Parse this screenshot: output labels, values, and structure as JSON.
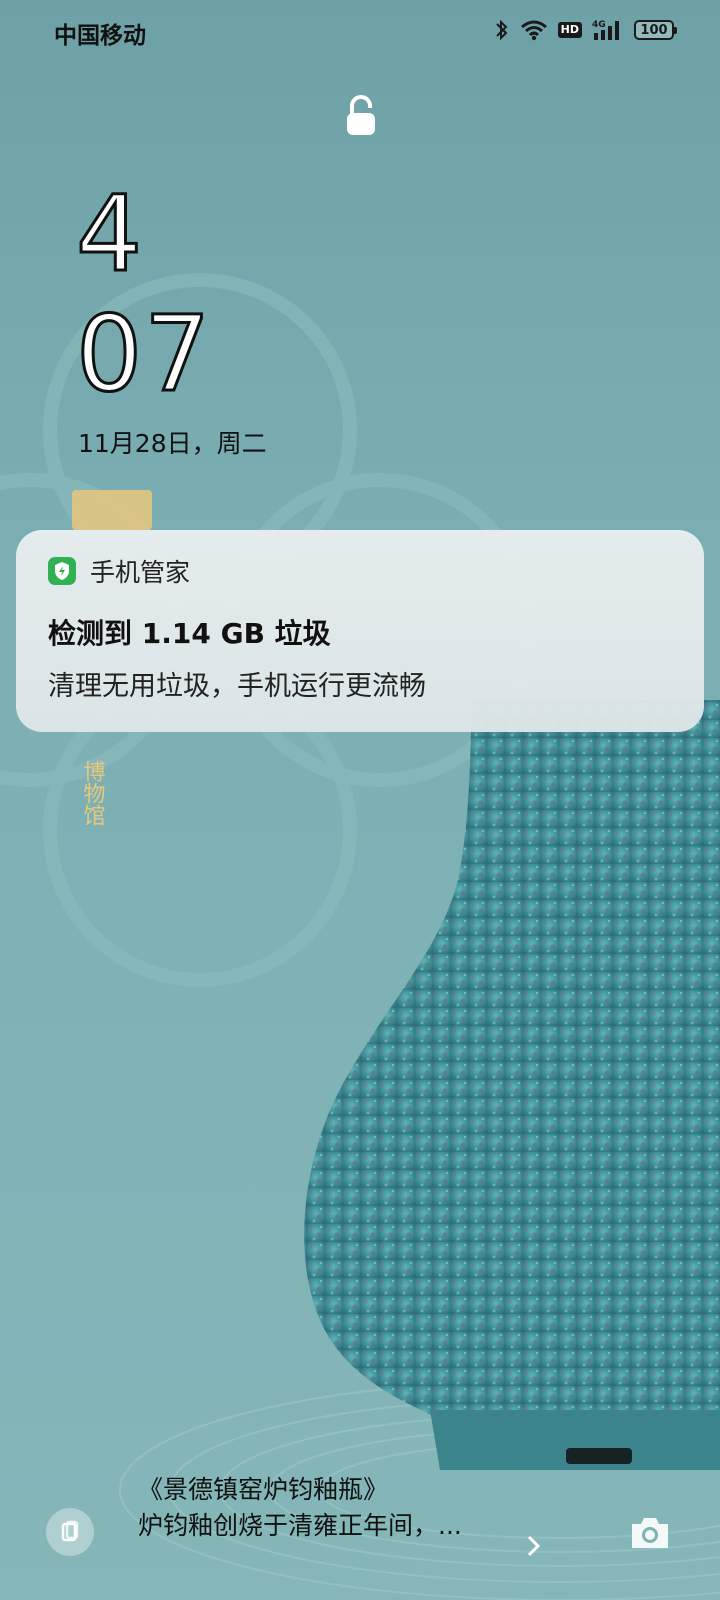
{
  "status_bar": {
    "carrier": "中国移动",
    "hd_label": "HD",
    "network_label": "4G",
    "battery_level": "100",
    "icons": [
      "bluetooth-icon",
      "wifi-icon",
      "hd-icon",
      "signal-icon",
      "battery-icon"
    ]
  },
  "lock_screen": {
    "hour": "4",
    "minute": "07",
    "date": "11月28日，周二"
  },
  "notification": {
    "app_name": "手机管家",
    "title": "检测到 1.14 GB 垃圾",
    "body": "清理无用垃圾，手机运行更流畅"
  },
  "wallpaper": {
    "museum_name": "博物馆",
    "caption_title": "《景德镇窑炉钧釉瓶》",
    "caption_text": "炉钧釉创烧于清雍正年间，..."
  },
  "colors": {
    "background": "#79adb1",
    "vase": "#4a9ba2",
    "accent_green": "#2fb154"
  }
}
